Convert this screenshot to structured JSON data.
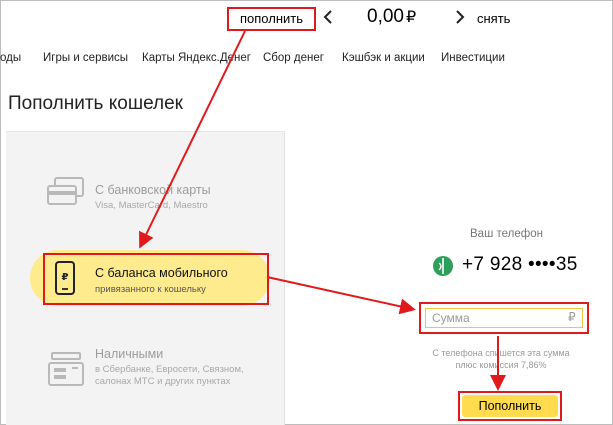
{
  "header": {
    "topup_label": "пополнить",
    "balance_amount": "0,00",
    "balance_currency": "₽",
    "withdraw_label": "снять"
  },
  "nav": {
    "items": [
      "оды",
      "Игры и сервисы",
      "Карты Яндекс.Денег",
      "Сбор денег",
      "Кэшбэк и акции",
      "Инвестиции"
    ]
  },
  "page": {
    "title": "Пополнить кошелек"
  },
  "methods": [
    {
      "title": "С банковской карты",
      "subtitle": "Visa, MasterCard, Maestro",
      "icon": "bank-card-icon"
    },
    {
      "title": "С баланса мобильного",
      "subtitle": "привязанного к кошельку",
      "icon": "mobile-phone-ruble-icon"
    },
    {
      "title": "Наличными",
      "subtitle_lines": [
        "в Сбербанке, Евросети, Связном,",
        "салонах МТС и других пунктах"
      ],
      "icon": "cash-terminal-icon"
    }
  ],
  "payment": {
    "phone_label": "Ваш телефон",
    "phone_number": "+7 928 ••••35",
    "operator_icon": "operator-logo-icon",
    "amount_placeholder": "Сумма",
    "amount_currency": "₽",
    "commission_lines": [
      "С телефона спишется эта сумма",
      "плюс комиссия 7,86%"
    ],
    "submit_label": "Пополнить"
  },
  "colors": {
    "highlight_red": "#e2191c",
    "accent_yellow": "#ffdb4d",
    "selected_bg": "#fdeb8e",
    "operator_green": "#2e9e5b"
  }
}
